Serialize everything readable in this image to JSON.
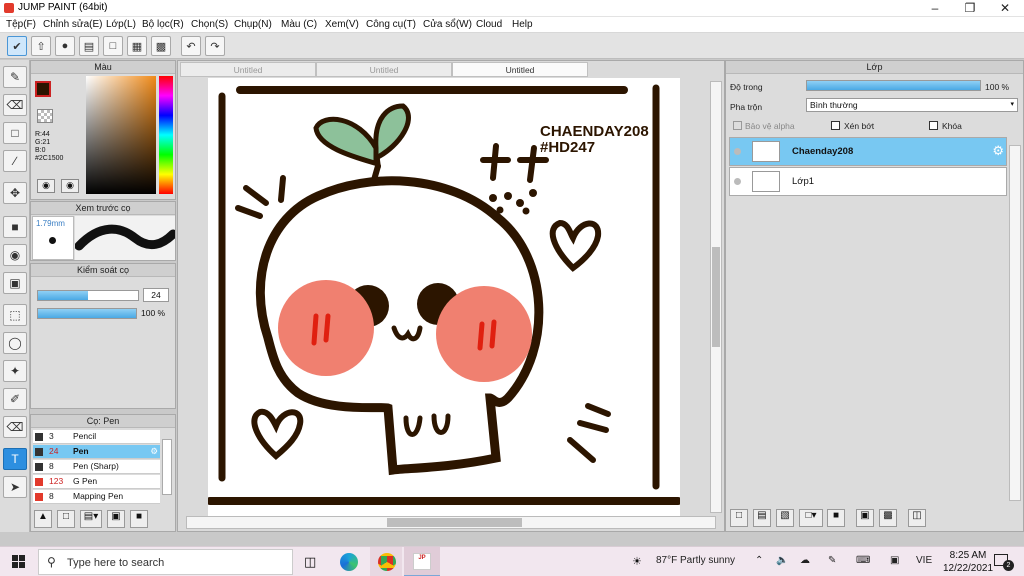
{
  "window": {
    "title": "JUMP PAINT (64bit)"
  },
  "menu": [
    "Tệp(F)",
    "Chỉnh sửa(E)",
    "Lớp(L)",
    "Bộ lọc(R)",
    "Chọn(S)",
    "Chụp(N)",
    "Màu (C)",
    "Xem(V)",
    "Công cụ(T)",
    "Cửa sổ(W)",
    "Cloud",
    "Help"
  ],
  "color_panel": {
    "title": "Màu",
    "r": "R:44",
    "g": "G:21",
    "b": "B:0",
    "hex": "#2C1500",
    "main_color": "#2c1500",
    "sub_color": "#8ec38f"
  },
  "brush_preview": {
    "title": "Xem trước cọ",
    "size": "1.79mm"
  },
  "brush_control": {
    "title": "Kiểm soát cọ",
    "size_value": "24",
    "opacity_value": "100 %",
    "size_fraction": 0.5,
    "opacity_fraction": 1.0
  },
  "brush_list": {
    "title": "Cọ: Pen",
    "items": [
      {
        "size": "3",
        "name": "Pencil",
        "selected": false
      },
      {
        "size": "24",
        "name": "Pen",
        "selected": true
      },
      {
        "size": "8",
        "name": "Pen (Sharp)",
        "selected": false
      },
      {
        "size": "123",
        "name": "G Pen",
        "selected": false
      },
      {
        "size": "8",
        "name": "Mapping Pen",
        "selected": false
      }
    ]
  },
  "document_tabs": [
    "Untitled",
    "Untitled",
    "Untitled"
  ],
  "artwork": {
    "signature": "CHAENDAY208",
    "hashtag": "#HD247"
  },
  "layer_panel": {
    "title": "Lớp",
    "opacity_label": "Độ trong",
    "opacity_value": "100 %",
    "opacity_fraction": 1.0,
    "blend_label": "Pha trộn",
    "blend_value": "Bình thường",
    "protect_alpha": "Bảo vệ alpha",
    "clipping": "Xén bớt",
    "lock": "Khóa",
    "layers": [
      {
        "name": "Chaenday208",
        "selected": true
      },
      {
        "name": "Lớp1",
        "selected": false
      }
    ]
  },
  "taskbar": {
    "search_placeholder": "Type here to search",
    "weather": "87°F  Partly sunny",
    "language": "VIE",
    "time": "8:25 AM",
    "date": "12/22/2021",
    "notification_count": "2"
  }
}
